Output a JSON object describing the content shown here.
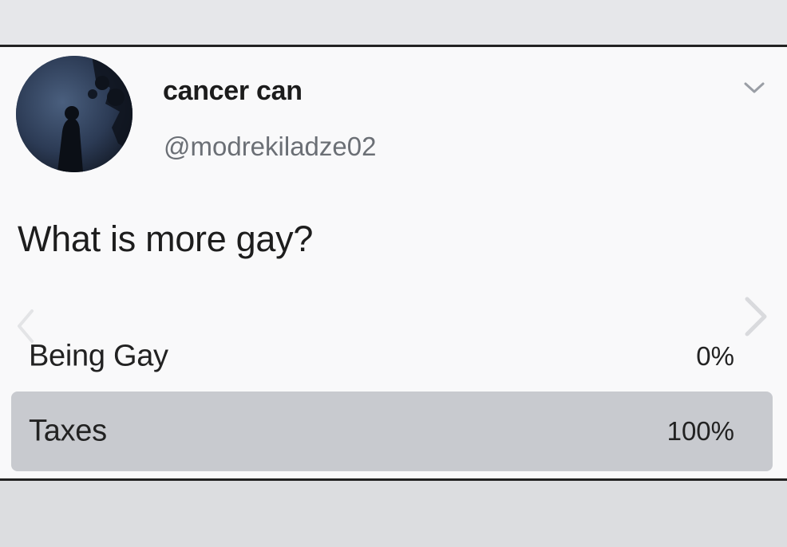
{
  "post": {
    "display_name": "cancer can",
    "handle": "@modrekiladze02",
    "question": "What is more gay?"
  },
  "poll": {
    "options": [
      {
        "label": "Being Gay",
        "percent_text": "0%",
        "percent": 0
      },
      {
        "label": "Taxes",
        "percent_text": "100%",
        "percent": 100
      }
    ]
  },
  "icons": {
    "menu": "chevron-down-icon",
    "prev": "chevron-left-icon",
    "next": "chevron-right-icon"
  },
  "colors": {
    "card_bg": "#f9f9fa",
    "poll_bar": "#c8cacf",
    "handle_text": "#6b6f75",
    "avatar_bg": "#243043"
  }
}
